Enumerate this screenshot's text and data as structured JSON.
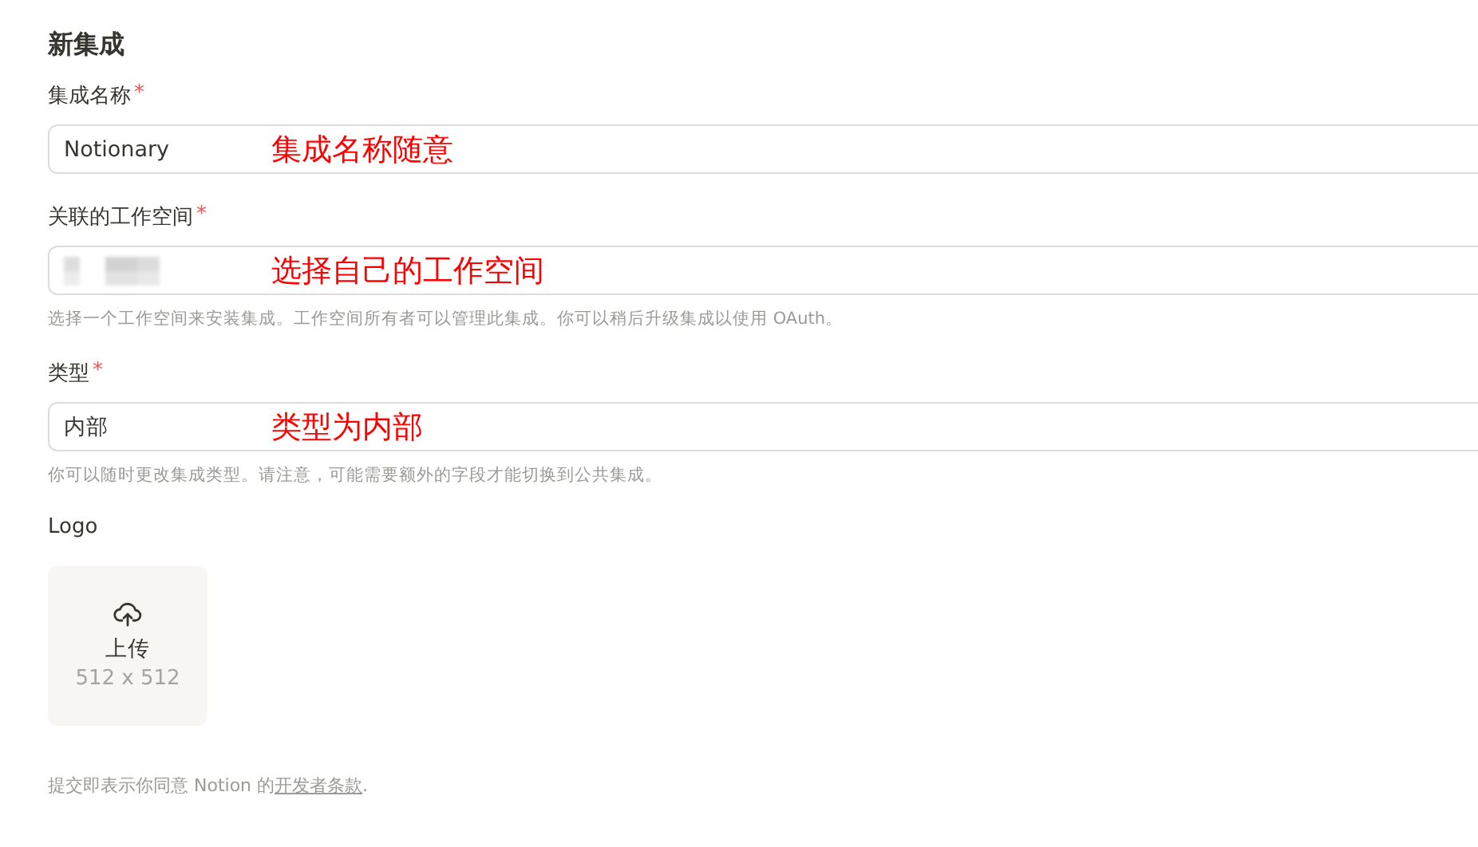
{
  "title": "新集成",
  "fields": [
    {
      "kind": "text",
      "label": "集成名称",
      "required_mark": "*",
      "value": "Notionary",
      "annotation": "集成名称随意"
    },
    {
      "kind": "redacted",
      "label": "关联的工作空间",
      "required_mark": "*",
      "annotation": "选择自己的工作空间",
      "hint": "选择一个工作空间来安装集成。工作空间所有者可以管理此集成。你可以稍后升级集成以使用 OAuth。"
    },
    {
      "kind": "text",
      "label": "类型",
      "required_mark": "*",
      "value": "内部",
      "annotation": "类型为内部",
      "hint": "你可以随时更改集成类型。请注意，可能需要额外的字段才能切换到公共集成。"
    }
  ],
  "logo": {
    "label": "Logo",
    "upload_label": "上传",
    "size": "512 x 512"
  },
  "footer": {
    "before": "提交即表示你同意 Notion 的",
    "link": "开发者条款",
    "after": "."
  }
}
